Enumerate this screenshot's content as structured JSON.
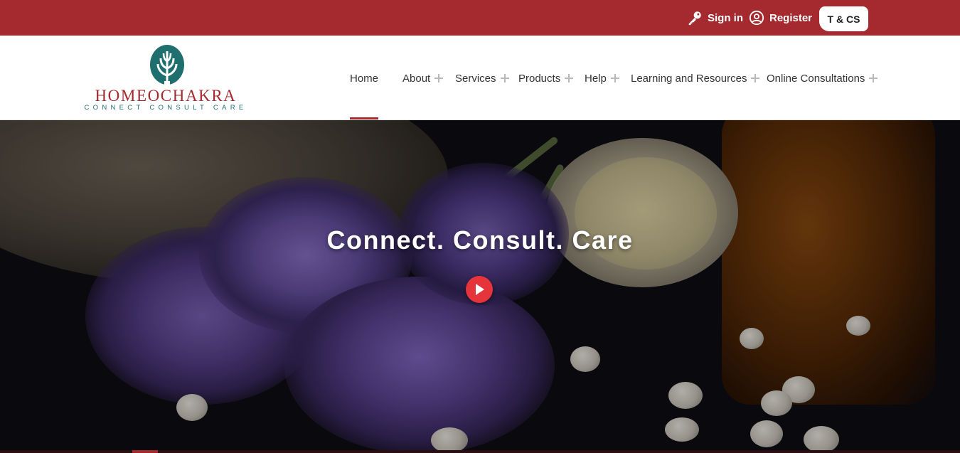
{
  "topbar": {
    "signin_label": "Sign in",
    "register_label": "Register",
    "tcs_label": "T & CS",
    "background_color": "#a52a2f"
  },
  "logo": {
    "brand": "HOMEOCHAKRA",
    "tagline": "CONNECT CONSULT CARE",
    "icon": "leaf-tree-icon"
  },
  "nav": {
    "items": [
      {
        "label": "Home",
        "active": true,
        "has_submenu": false
      },
      {
        "label": "About",
        "has_submenu": true
      },
      {
        "label": "Services",
        "has_submenu": true
      },
      {
        "label": "Products",
        "has_submenu": true
      },
      {
        "label": "Help",
        "has_submenu": true
      },
      {
        "label": "Learning and Resources",
        "has_submenu": true
      },
      {
        "label": "Online Consultations",
        "has_submenu": true
      }
    ]
  },
  "hero": {
    "headline": "Connect. Consult. Care",
    "play_icon": "play-icon",
    "accent_color": "#e5343a"
  }
}
